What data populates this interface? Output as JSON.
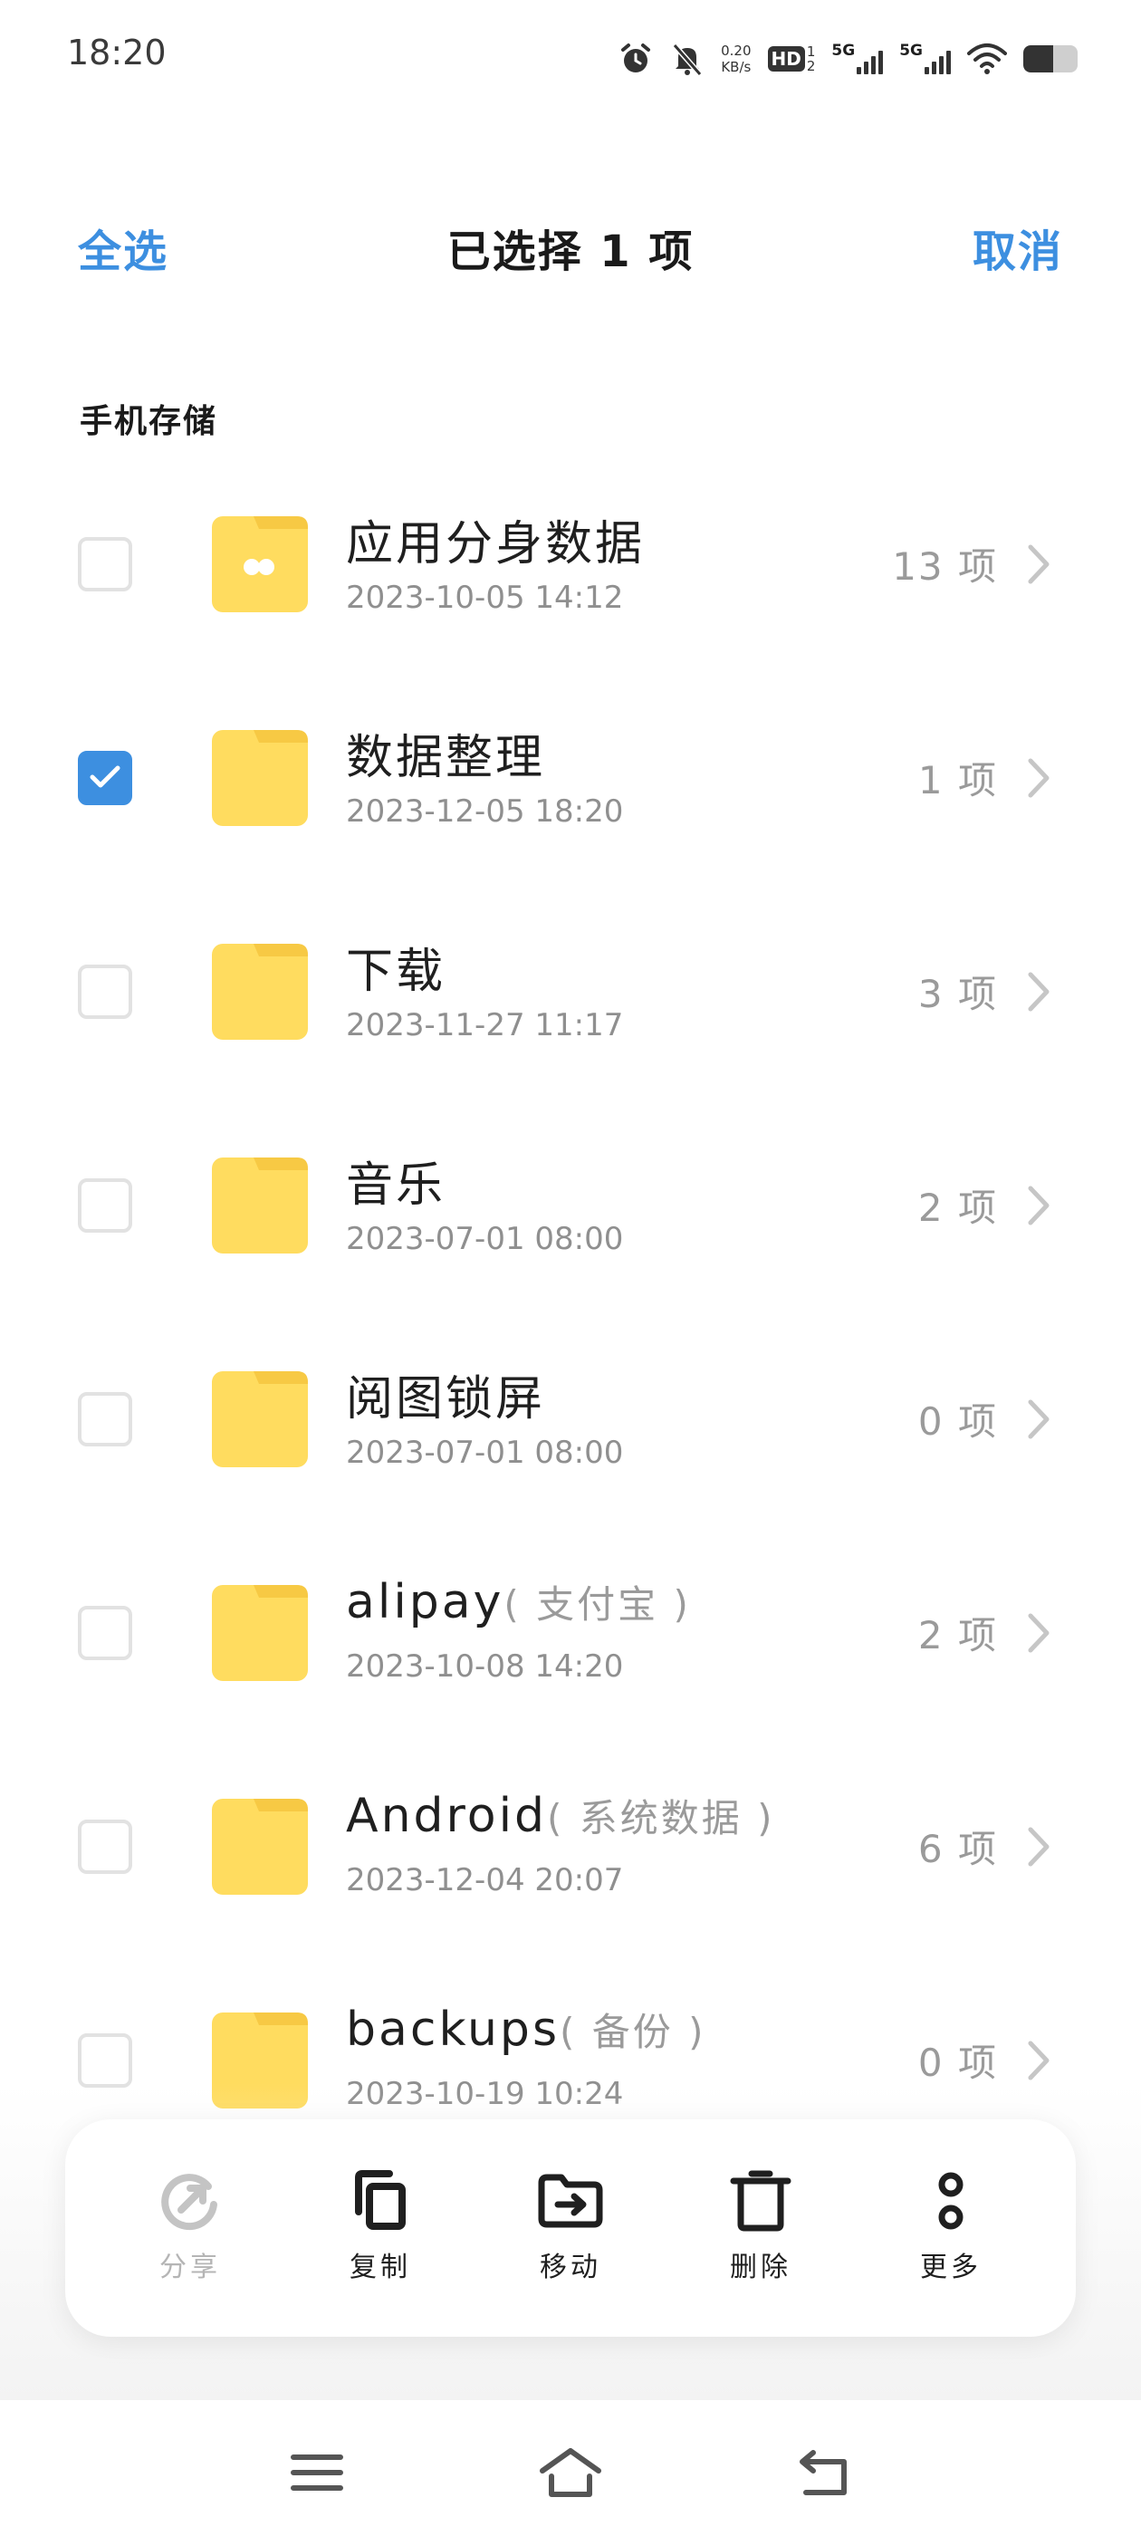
{
  "status_bar": {
    "time": "18:20",
    "net_speed_value": "0.20",
    "net_speed_unit": "KB/s",
    "hd_label": "HD",
    "hd_sim1": "1",
    "hd_sim2": "2",
    "sim1_label": "5G",
    "sim2_label": "5G",
    "battery_level": 0.55,
    "icons": [
      "alarm-icon",
      "mute-bell-icon",
      "wifi-icon",
      "battery-icon"
    ]
  },
  "header": {
    "select_all": "全选",
    "title": "已选择 1 项",
    "cancel": "取消"
  },
  "section": {
    "label": "手机存储"
  },
  "files": [
    {
      "name": "应用分身数据",
      "sub": "",
      "date": "2023-10-05 14:12",
      "count": "13 项",
      "checked": false,
      "icon": "app-clone-folder-icon"
    },
    {
      "name": "数据整理",
      "sub": "",
      "date": "2023-12-05 18:20",
      "count": "1 项",
      "checked": true,
      "icon": "folder-icon"
    },
    {
      "name": "下载",
      "sub": "",
      "date": "2023-11-27 11:17",
      "count": "3 项",
      "checked": false,
      "icon": "folder-icon"
    },
    {
      "name": "音乐",
      "sub": "",
      "date": "2023-07-01 08:00",
      "count": "2 项",
      "checked": false,
      "icon": "folder-icon"
    },
    {
      "name": "阅图锁屏",
      "sub": "",
      "date": "2023-07-01 08:00",
      "count": "0 项",
      "checked": false,
      "icon": "folder-icon"
    },
    {
      "name": "alipay",
      "sub": "( 支付宝 )",
      "date": "2023-10-08 14:20",
      "count": "2 项",
      "checked": false,
      "icon": "folder-icon"
    },
    {
      "name": "Android",
      "sub": "( 系统数据 )",
      "date": "2023-12-04 20:07",
      "count": "6 项",
      "checked": false,
      "icon": "folder-icon"
    },
    {
      "name": "backups",
      "sub": "( 备份 )",
      "date": "2023-10-19 10:24",
      "count": "0 项",
      "checked": false,
      "icon": "folder-icon"
    }
  ],
  "actions": [
    {
      "label": "分享",
      "icon": "share-icon",
      "enabled": false
    },
    {
      "label": "复制",
      "icon": "copy-icon",
      "enabled": true
    },
    {
      "label": "移动",
      "icon": "move-folder-icon",
      "enabled": true
    },
    {
      "label": "删除",
      "icon": "delete-icon",
      "enabled": true
    },
    {
      "label": "更多",
      "icon": "more-icon",
      "enabled": true
    }
  ],
  "nav": {
    "icons": [
      "menu-icon",
      "home-icon",
      "back-icon"
    ]
  },
  "colors": {
    "accent": "#3d8fe0",
    "folder": "#ffdc5f",
    "folder_tab": "#f7c944",
    "checkbox_border": "#e2e2e2"
  }
}
